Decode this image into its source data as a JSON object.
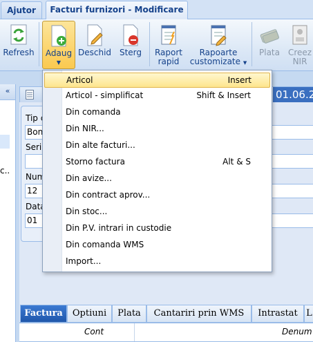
{
  "tabs": {
    "help": "Ajutor",
    "active": "Facturi furnizori - Modificare"
  },
  "ribbon": {
    "refresh": "Refresh",
    "add": "Adaug",
    "open": "Deschid",
    "delete": "Sterg",
    "report_quick_1": "Raport",
    "report_quick_2": "rapid",
    "report_custom_1": "Rapoarte",
    "report_custom_2": "customizate",
    "pay": "Plata",
    "create_nir_1": "Creez",
    "create_nir_2": "NIR"
  },
  "left": {
    "collapse": "«",
    "partial": "c.."
  },
  "main": {
    "header_date": "01.06.20",
    "fields": [
      {
        "label": "Tip c",
        "value": "Bon"
      },
      {
        "label": "Seri",
        "value": ""
      },
      {
        "label": "Num",
        "value": "12"
      },
      {
        "label": "Data",
        "value": "01"
      }
    ]
  },
  "menu": {
    "items": [
      {
        "label": "Articol",
        "shortcut": "Insert"
      },
      {
        "label": "Articol - simplificat",
        "shortcut": "Shift & Insert"
      },
      {
        "label": "Din comanda",
        "shortcut": ""
      },
      {
        "label": "Din NIR...",
        "shortcut": ""
      },
      {
        "label": "Din alte facturi...",
        "shortcut": ""
      },
      {
        "label": "Storno factura",
        "shortcut": "Alt & S"
      },
      {
        "label": "Din avize...",
        "shortcut": ""
      },
      {
        "label": "Din contract aprov...",
        "shortcut": ""
      },
      {
        "label": "Din stoc...",
        "shortcut": ""
      },
      {
        "label": "Din P.V. intrari in custodie",
        "shortcut": ""
      },
      {
        "label": "Din comanda WMS",
        "shortcut": ""
      },
      {
        "label": "Import...",
        "shortcut": ""
      }
    ]
  },
  "bottom_tabs": [
    "Factura",
    "Optiuni",
    "Plata",
    "Cantariri prin WMS",
    "Intrastat",
    "L"
  ],
  "grid": {
    "col1": "Cont",
    "col2": "Denum"
  },
  "colors": {
    "accent": "#15428b",
    "highlight": "#fde58d",
    "active_tab": "#1f57ab"
  }
}
